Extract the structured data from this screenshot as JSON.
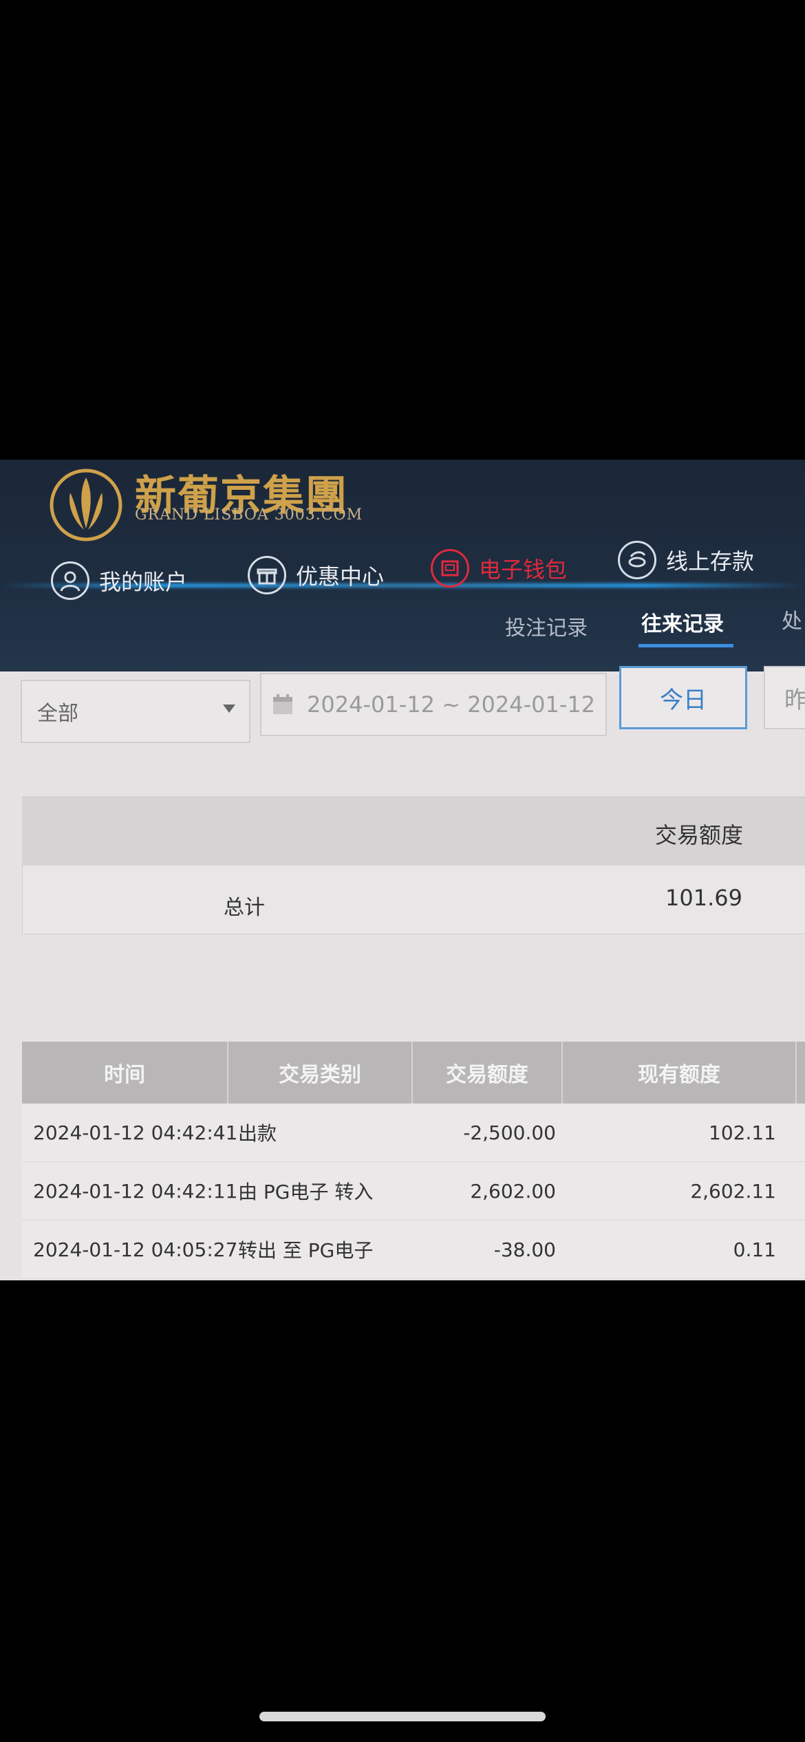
{
  "brand": {
    "name_cn": "新葡京集團",
    "name_en": "GRAND LISBOA 3003.COM",
    "gold": "#cfa14a"
  },
  "nav": [
    {
      "label": "我的账户",
      "icon": "user-icon"
    },
    {
      "label": "优惠中心",
      "icon": "gift-icon"
    },
    {
      "label": "电子钱包",
      "icon": "wallet-icon",
      "active": true
    },
    {
      "label": "线上存款",
      "icon": "deposit-icon"
    }
  ],
  "subtabs": [
    {
      "label": "投注记录"
    },
    {
      "label": "往来记录",
      "active": true
    },
    {
      "label": "处"
    }
  ],
  "filter": {
    "type_select": "全部",
    "date_range": "2024-01-12 ~ 2024-01-12",
    "today_button": "今日",
    "yesterday_button": "昨"
  },
  "summary": {
    "header_amount": "交易额度",
    "total_label": "总计",
    "total_value": "101.69"
  },
  "table": {
    "headers": [
      "时间",
      "交易类别",
      "交易额度",
      "现有额度"
    ],
    "rows": [
      {
        "time": "2024-01-12 04:42:41",
        "type": "出款",
        "amount": "-2,500.00",
        "balance": "102.11"
      },
      {
        "time": "2024-01-12 04:42:11",
        "type": "由 PG电子 转入",
        "amount": "2,602.00",
        "balance": "2,602.11"
      },
      {
        "time": "2024-01-12 04:05:27",
        "type": "转出 至 PG电子",
        "amount": "-38.00",
        "balance": "0.11"
      }
    ]
  },
  "colors": {
    "header_bg": "#1e2d40",
    "accent_blue": "#3b8fe0",
    "active_red": "#e0293d"
  }
}
